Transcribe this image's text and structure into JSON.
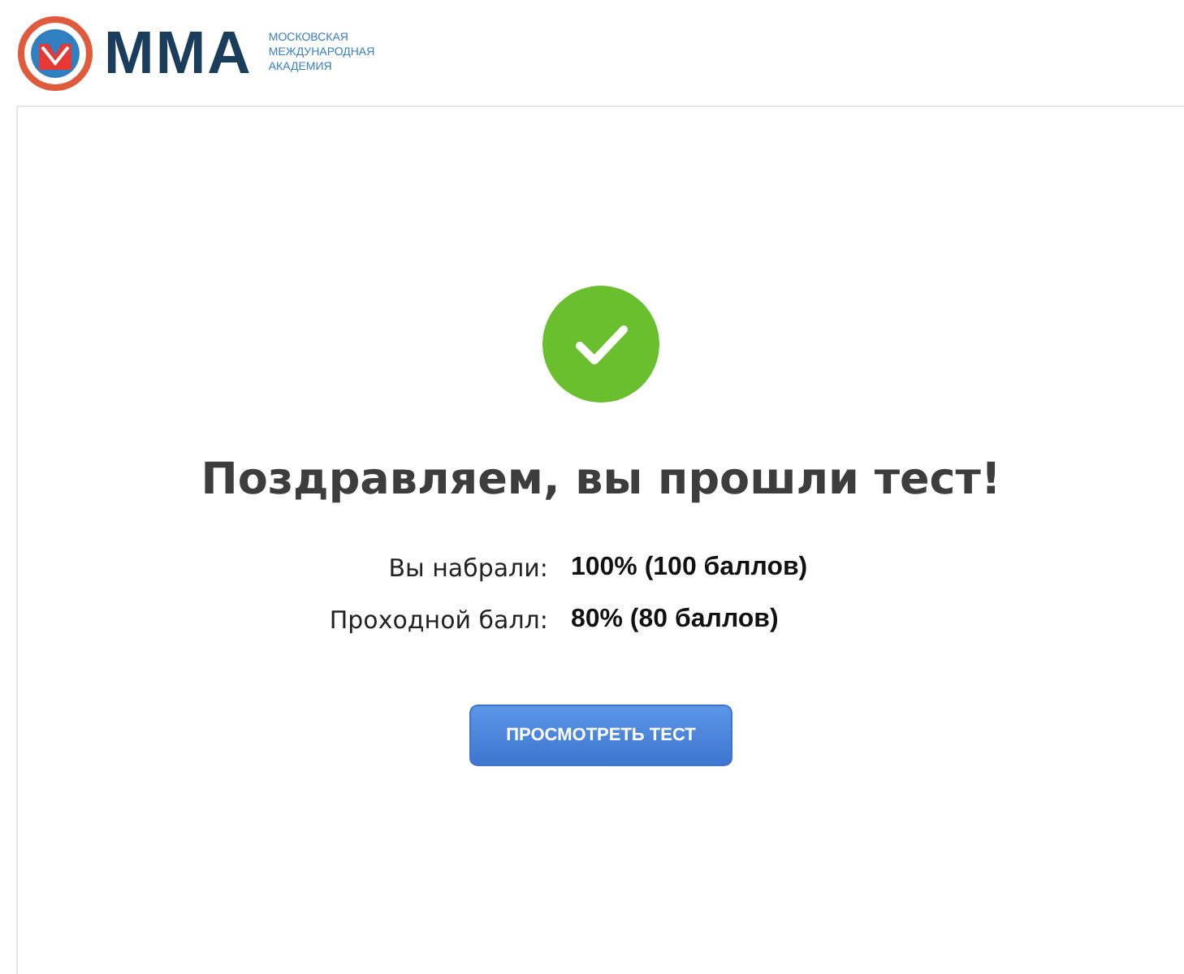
{
  "header": {
    "logo_text": "ММА",
    "logo_subtitle": [
      "МОСКОВСКАЯ",
      "МЕЖДУНАРОДНАЯ",
      "АКАДЕМИЯ"
    ]
  },
  "result": {
    "passed": true,
    "title": "Поздравляем, вы прошли тест!",
    "rows": [
      {
        "label": "Вы набрали:",
        "value": "100% (100 баллов)"
      },
      {
        "label": "Проходной балл:",
        "value": "80% (80 баллов)"
      }
    ],
    "button": "ПРОСМОТРЕТЬ ТЕСТ"
  }
}
